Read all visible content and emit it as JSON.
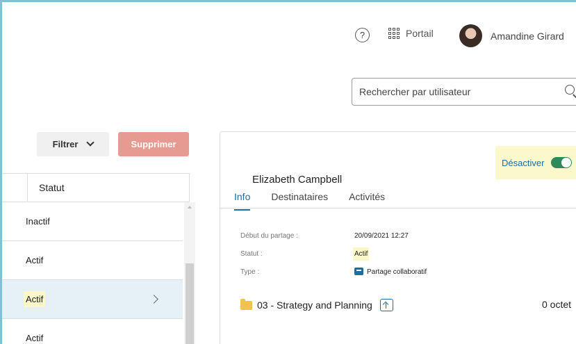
{
  "header": {
    "help_icon": "?",
    "portal_label": "Portail",
    "user_name": "Amandine Girard"
  },
  "search": {
    "placeholder": "Rechercher par utilisateur"
  },
  "toolbar": {
    "filter_label": "Filtrer",
    "delete_label": "Supprimer"
  },
  "table": {
    "column_status": "Statut",
    "rows": [
      {
        "status": "Inactif"
      },
      {
        "status": "Actif"
      },
      {
        "status": "Actif",
        "selected": true
      },
      {
        "status": "Actif"
      }
    ]
  },
  "detail": {
    "title": "Elizabeth Campbell",
    "deactivate_label": "Désactiver",
    "toggle_on": true,
    "tabs": [
      {
        "label": "Info",
        "active": true
      },
      {
        "label": "Destinataires"
      },
      {
        "label": "Activités"
      }
    ],
    "info": {
      "start_label": "Début du partage :",
      "start_value": "20/09/2021 12:27",
      "status_label": "Statut :",
      "status_value": "Actif",
      "type_label": "Type :",
      "type_value": "Partage collaboratif"
    },
    "folder": {
      "name": "03 - Strategy and Planning",
      "size": "0 octet"
    }
  },
  "colors": {
    "accent": "#1f6ca0",
    "delete_button": "#e79a91",
    "highlight": "#fbf7c9",
    "selected_row": "#e5f1f7",
    "toggle": "#2d8b5b",
    "frame_border": "#7fc1d6"
  }
}
